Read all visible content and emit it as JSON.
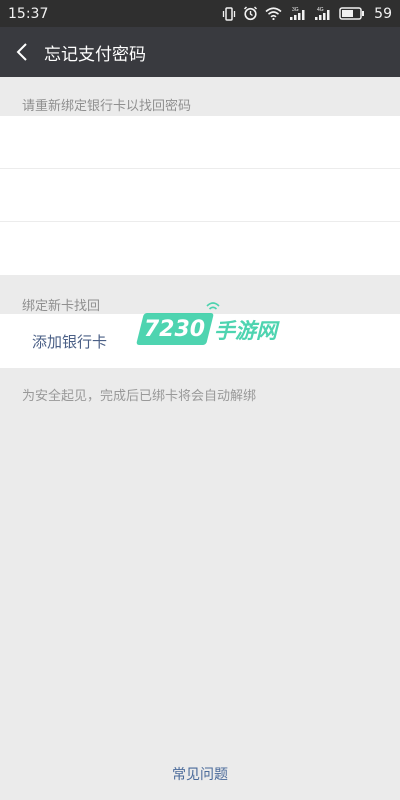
{
  "status_bar": {
    "time": "15:37",
    "signal_3g": "3G",
    "signal_4g": "4G",
    "battery": "59"
  },
  "header": {
    "title": "忘记支付密码"
  },
  "rebind_section": {
    "label": "请重新绑定银行卡以找回密码",
    "rows": [
      "",
      "",
      ""
    ]
  },
  "new_card_section": {
    "label": "绑定新卡找回",
    "add_card_label": "添加银行卡",
    "note": "为安全起见，完成后已绑卡将会自动解绑"
  },
  "footer": {
    "faq_link": "常见问题"
  },
  "watermark": {
    "number": "7230",
    "text": "手游网"
  },
  "colors": {
    "status_bar_bg": "#2f2f2f",
    "title_bar_bg": "#393a3f",
    "page_bg": "#ebebeb",
    "link_blue": "#4a6a9a",
    "watermark_green": "#3bd0a8"
  }
}
